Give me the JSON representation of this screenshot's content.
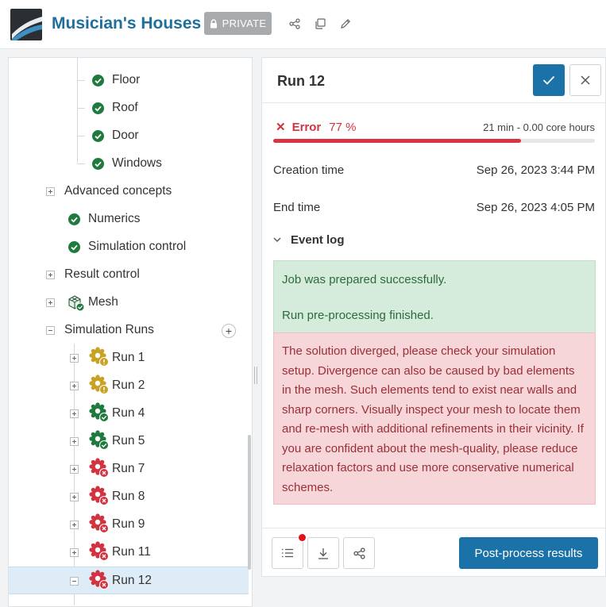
{
  "header": {
    "project_title": "Musician's Houses",
    "private_label": "PRIVATE",
    "icons": [
      "share-icon",
      "copy-icon",
      "edit-icon"
    ]
  },
  "tree": {
    "geometry_children": [
      "Floor",
      "Roof",
      "Door",
      "Windows"
    ],
    "advanced_concepts": "Advanced concepts",
    "numerics": "Numerics",
    "simulation_control": "Simulation control",
    "result_control": "Result control",
    "mesh": "Mesh",
    "simulation_runs": "Simulation Runs",
    "runs": [
      {
        "label": "Run 1",
        "status": "warning"
      },
      {
        "label": "Run 2",
        "status": "warning"
      },
      {
        "label": "Run 4",
        "status": "success"
      },
      {
        "label": "Run 5",
        "status": "success"
      },
      {
        "label": "Run 7",
        "status": "error"
      },
      {
        "label": "Run 8",
        "status": "error"
      },
      {
        "label": "Run 9",
        "status": "error"
      },
      {
        "label": "Run 11",
        "status": "error"
      },
      {
        "label": "Run 12",
        "status": "error",
        "selected": true
      }
    ]
  },
  "run": {
    "title": "Run 12",
    "status_label": "Error",
    "progress_text": "77 %",
    "progress_value": 0.77,
    "duration": "21 min - 0.00 core hours",
    "creation_label": "Creation time",
    "creation_value": "Sep 26, 2023 3:44 PM",
    "end_label": "End time",
    "end_value": "Sep 26, 2023 4:05 PM",
    "event_log_label": "Event log",
    "log_success": [
      "Job was prepared successfully.",
      "Run pre-processing finished."
    ],
    "log_error": "The solution diverged, please check your simulation setup. Divergence can also be caused by bad elements in the mesh. Such elements tend to exist near walls and sharp corners. Visually inspect your mesh to locate them and re-mesh with additional refinements in their vicinity. If you are confident about the mesh-quality, please reduce relaxation factors and use more conservative numerical schemes.",
    "post_process_label": "Post-process results"
  },
  "colors": {
    "brand": "#1f6e9c",
    "primary_button": "#1a72a8",
    "success": "#1f7a3d",
    "warning": "#c9a224",
    "error": "#d23340"
  }
}
